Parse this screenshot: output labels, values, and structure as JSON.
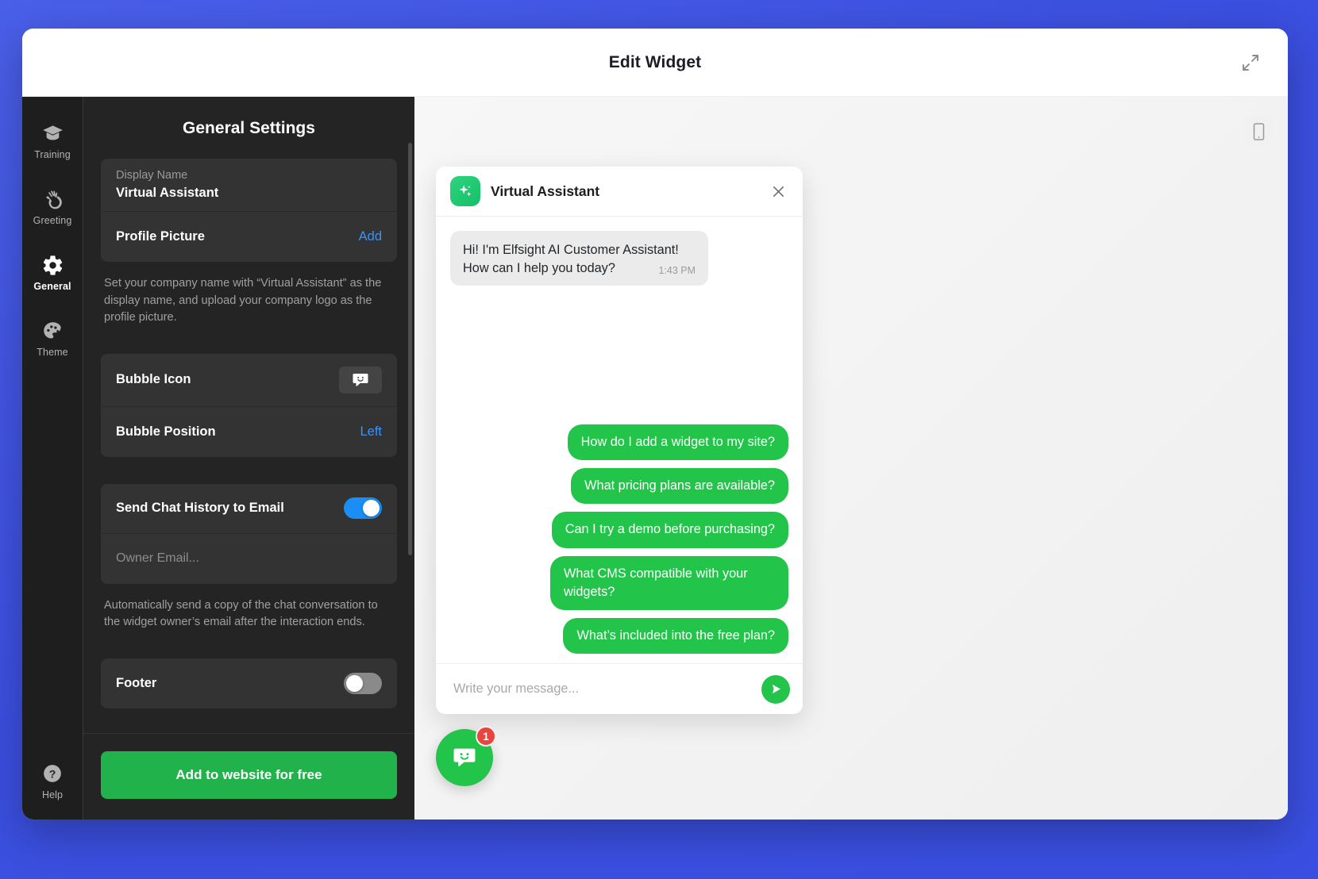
{
  "window": {
    "title": "Edit Widget",
    "expand_icon": "expand-arrows-icon"
  },
  "rail": {
    "items": [
      {
        "label": "Training",
        "icon": "graduation-cap-icon",
        "active": false
      },
      {
        "label": "Greeting",
        "icon": "waving-hand-icon",
        "active": false
      },
      {
        "label": "General",
        "icon": "gear-icon",
        "active": true
      },
      {
        "label": "Theme",
        "icon": "palette-icon",
        "active": false
      }
    ],
    "help": {
      "label": "Help",
      "icon": "question-circle-icon"
    }
  },
  "panel": {
    "title": "General Settings",
    "display_name": {
      "label": "Display Name",
      "value": "Virtual Assistant"
    },
    "profile_picture": {
      "label": "Profile Picture",
      "action": "Add"
    },
    "help_text_1": "Set your company name with “Virtual Assistant” as the display name, and upload your company logo as the profile picture.",
    "bubble_icon": {
      "label": "Bubble Icon",
      "icon": "chat-bubble-smiley-icon"
    },
    "bubble_position": {
      "label": "Bubble Position",
      "value": "Left"
    },
    "send_chat_history": {
      "label": "Send Chat History to Email",
      "enabled": true
    },
    "owner_email": {
      "placeholder": "Owner Email...",
      "value": ""
    },
    "help_text_2": "Automatically send a copy of the chat conversation to the widget owner’s email after the interaction ends.",
    "footer_toggle": {
      "label": "Footer",
      "enabled": false
    },
    "cta": "Add to website for free"
  },
  "preview": {
    "device_button": "mobile-device-icon",
    "widget": {
      "name": "Virtual Assistant",
      "avatar_icon": "sparkles-icon",
      "close_icon": "close-icon",
      "messages": [
        {
          "from": "bot",
          "text": "Hi! I'm Elfsight AI Customer Assistant! How can I help you today?",
          "time": "1:43 PM"
        }
      ],
      "quick_replies": [
        "How do I add a widget to my site?",
        "What pricing plans are available?",
        "Can I try a demo before purchasing?",
        "What CMS compatible with your widgets?",
        "What’s included into the free plan?"
      ],
      "input_placeholder": "Write your message...",
      "send_icon": "send-icon"
    },
    "launcher": {
      "icon": "chat-bubble-smiley-icon",
      "badge": "1"
    }
  },
  "colors": {
    "accent_green": "#22c44a",
    "toggle_blue": "#1a8ef5",
    "link_blue": "#3b93f7",
    "badge_red": "#e8453c",
    "backdrop": "#3d55e8"
  }
}
